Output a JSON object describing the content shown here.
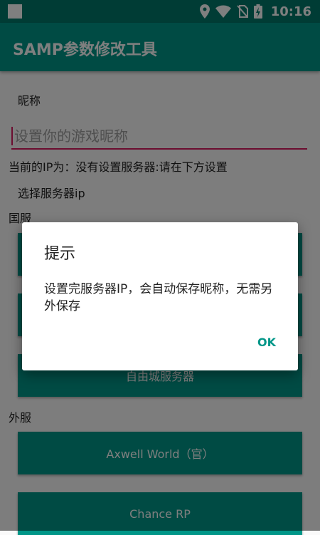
{
  "status_bar": {
    "time": "10:16",
    "icons": [
      "location-icon",
      "wifi-icon",
      "no-sim-icon",
      "battery-icon"
    ]
  },
  "app_bar": {
    "title": "SAMP参数修改工具"
  },
  "form": {
    "nickname_label": "昵称",
    "nickname_placeholder": "设置你的游戏昵称",
    "current_ip_text": "当前的IP为：没有设置服务器:请在下方设置",
    "select_server_label": "选择服务器ip"
  },
  "sections": {
    "domestic": {
      "label": "国服",
      "buttons": [
        "",
        "",
        "自由城服务器"
      ]
    },
    "foreign": {
      "label": "外服",
      "buttons": [
        "Axwell World（官）",
        "Chance RP"
      ]
    }
  },
  "dialog": {
    "title": "提示",
    "message": "设置完服务器IP，会自动保存昵称，无需另外保存",
    "ok_label": "OK"
  },
  "colors": {
    "primary": "#009688",
    "primary_dark": "#00796b",
    "accent": "#d81b60"
  }
}
